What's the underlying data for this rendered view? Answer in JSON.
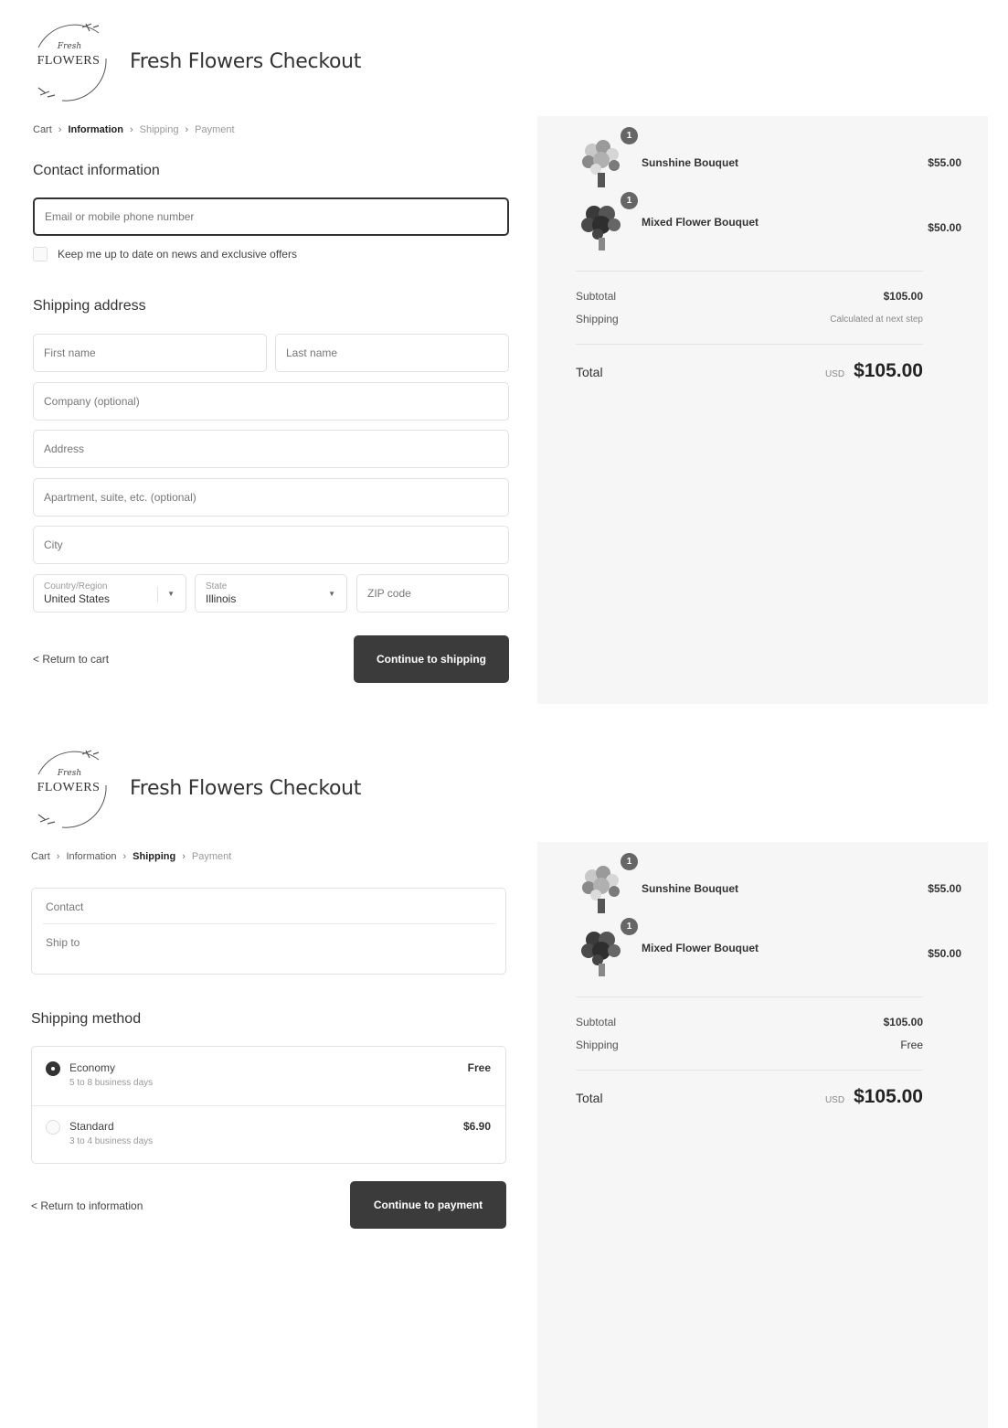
{
  "brand": {
    "logo_script": "Fresh",
    "logo_word": "FLOWERS",
    "title": "Fresh Flowers Checkout"
  },
  "screen1": {
    "breadcrumb": [
      "Cart",
      "Information",
      "Shipping",
      "Payment"
    ],
    "contact_title": "Contact information",
    "email_placeholder": "Email or mobile phone number",
    "newsletter_label": "Keep me up to date on news and exclusive offers",
    "shipping_title": "Shipping address",
    "first_name_placeholder": "First name",
    "last_name_placeholder": "Last name",
    "company_placeholder": "Company (optional)",
    "address_placeholder": "Address",
    "apartment_placeholder": "Apartment, suite, etc. (optional)",
    "city_placeholder": "City",
    "country_label": "Country/Region",
    "country_value": "United States",
    "state_label": "State",
    "state_value": "Illinois",
    "zip_placeholder": "ZIP code",
    "return_link": "< Return to cart",
    "continue_button": "Continue to shipping",
    "summary": {
      "items": [
        {
          "qty": "1",
          "name": "Sunshine Bouquet",
          "price": "$55.00"
        },
        {
          "qty": "1",
          "name": "Mixed Flower Bouquet",
          "price": "$50.00"
        }
      ],
      "subtotal_label": "Subtotal",
      "subtotal_value": "$105.00",
      "shipping_label": "Shipping",
      "shipping_value": "Calculated at next step",
      "total_label": "Total",
      "currency": "USD",
      "total_value": "$105.00"
    }
  },
  "screen2": {
    "breadcrumb": [
      "Cart",
      "Information",
      "Shipping",
      "Payment"
    ],
    "contact_label": "Contact",
    "ship_to_label": "Ship to",
    "method_title": "Shipping method",
    "options": [
      {
        "name": "Economy",
        "sub": "5 to 8 business days",
        "price": "Free",
        "selected": true
      },
      {
        "name": "Standard",
        "sub": "3 to 4 business days",
        "price": "$6.90",
        "selected": false
      }
    ],
    "return_link": "< Return to information",
    "continue_button": "Continue to payment",
    "summary": {
      "items": [
        {
          "qty": "1",
          "name": "Sunshine Bouquet",
          "price": "$55.00"
        },
        {
          "qty": "1",
          "name": "Mixed Flower Bouquet",
          "price": "$50.00"
        }
      ],
      "subtotal_label": "Subtotal",
      "subtotal_value": "$105.00",
      "shipping_label": "Shipping",
      "shipping_value": "Free",
      "total_label": "Total",
      "currency": "USD",
      "total_value": "$105.00"
    }
  },
  "colors": {
    "primary_button": "#3b3b3b",
    "summary_bg": "#f6f6f6",
    "border": "#e1e1e1"
  }
}
